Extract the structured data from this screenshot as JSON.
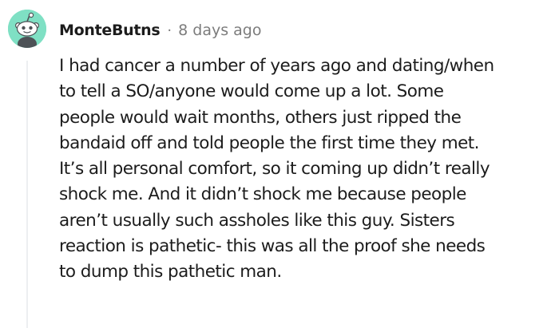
{
  "comment": {
    "author": "MonteButns",
    "separator": "·",
    "timestamp": "8 days ago",
    "avatar_icon": "snoo-avatar-icon",
    "avatar_color": "#7fe0c4",
    "body_lines": [
      "I had cancer a number of years ago and dating/when",
      "to tell a SO/anyone would come up a lot. Some",
      "people would wait months, others just ripped the",
      "bandaid off and told people the first time they met.",
      "It’s all personal comfort, so it coming up didn’t really",
      "shock me. And it didn’t shock me because people",
      "aren’t usually such assholes like this guy. Sisters",
      "reaction is pathetic- this was all the proof she needs",
      "to dump this pathetic man."
    ]
  }
}
